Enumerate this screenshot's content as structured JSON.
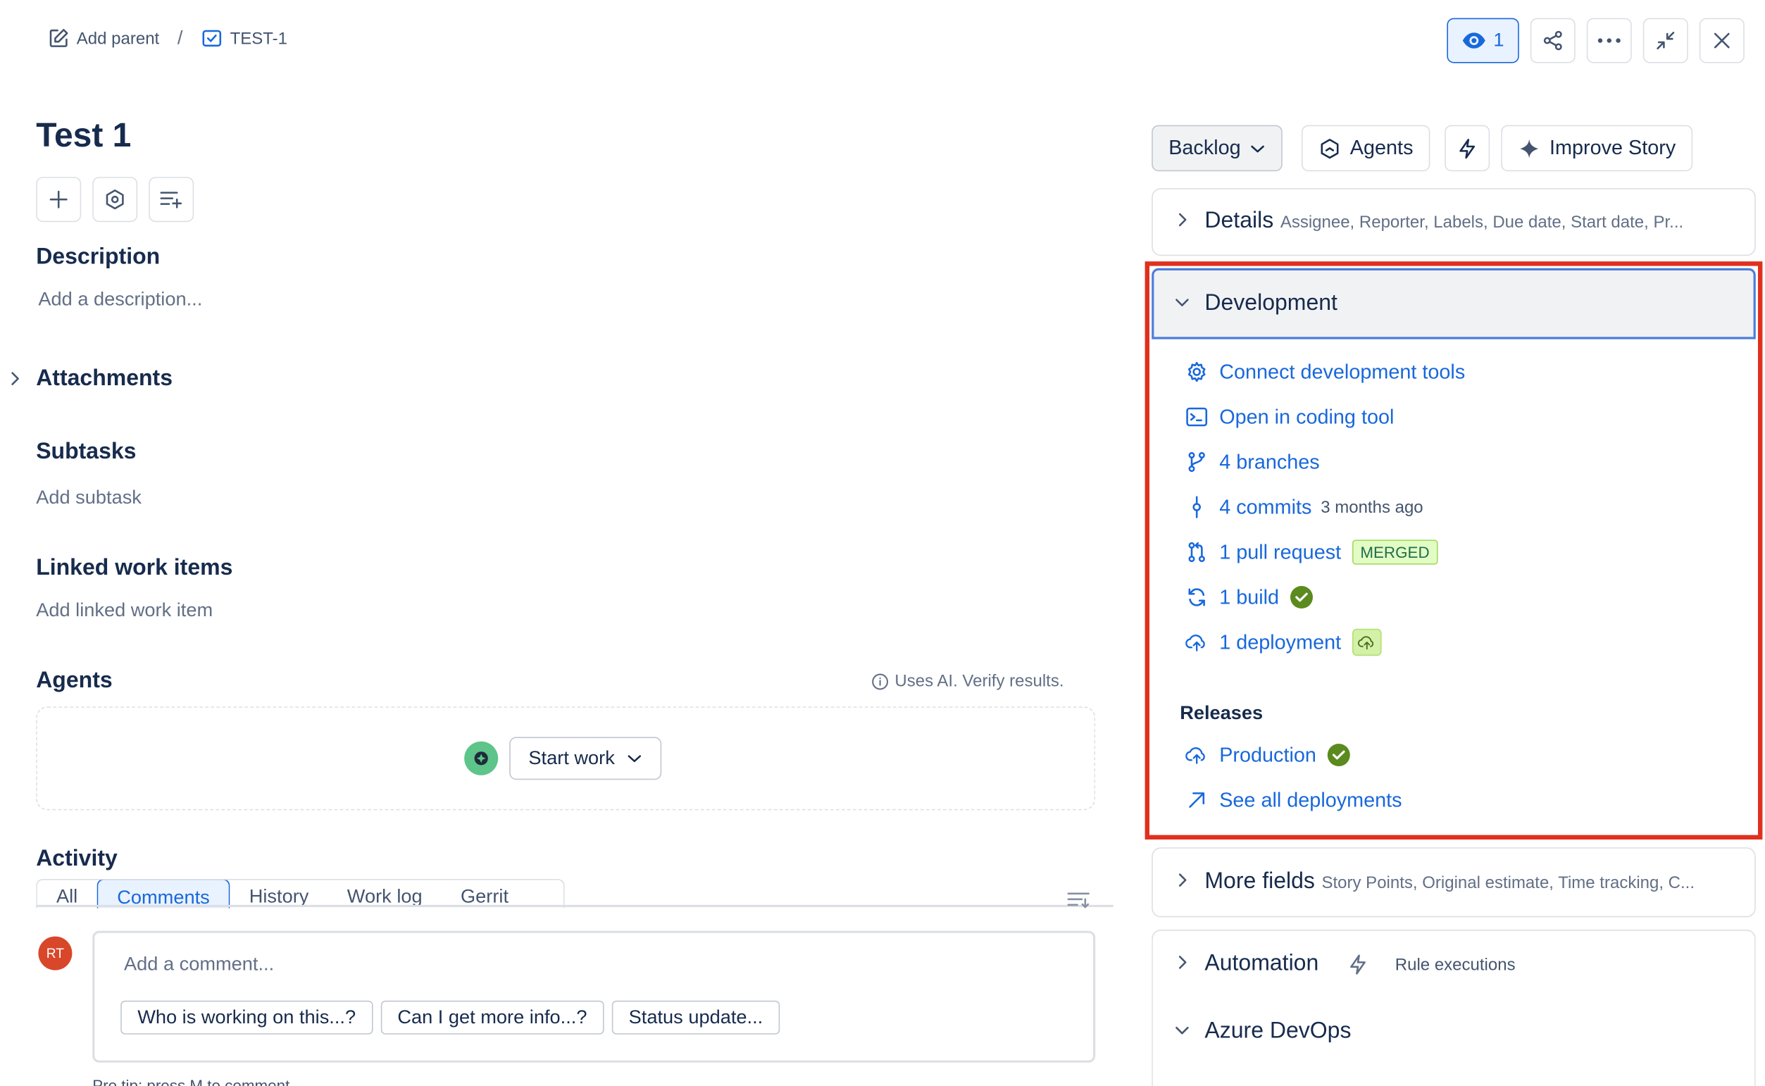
{
  "breadcrumb": {
    "add_parent": "Add parent",
    "separator": "/",
    "issue_key": "TEST-1"
  },
  "topbar": {
    "watch_count": "1"
  },
  "issue": {
    "title": "Test 1",
    "description_heading": "Description",
    "description_placeholder": "Add a description...",
    "attachments_heading": "Attachments",
    "subtasks_heading": "Subtasks",
    "subtasks_add": "Add subtask",
    "linked_heading": "Linked work items",
    "linked_add": "Add linked work item",
    "agents_heading": "Agents",
    "ai_notice": "Uses AI. Verify results.",
    "start_work": "Start work"
  },
  "activity": {
    "heading": "Activity",
    "tabs": [
      "All",
      "Comments",
      "History",
      "Work log",
      "Gerrit"
    ],
    "active_tab": "Comments",
    "avatar_initials": "RT",
    "comment_placeholder": "Add a comment...",
    "chips": [
      "Who is working on this...?",
      "Can I get more info...?",
      "Status update..."
    ],
    "pro_tip": "Pro tip: press M to comment"
  },
  "right": {
    "status": "Backlog",
    "agents_btn": "Agents",
    "improve_btn": "Improve Story",
    "details": {
      "title": "Details",
      "sub": "Assignee, Reporter, Labels, Due date, Start date, Pr..."
    },
    "development": {
      "title": "Development",
      "connect": "Connect development tools",
      "open_coding": "Open in coding tool",
      "branches": "4 branches",
      "commits": "4 commits",
      "commits_time": "3 months ago",
      "pull_request": "1 pull request",
      "merged": "MERGED",
      "build": "1 build",
      "deployment": "1 deployment",
      "releases_heading": "Releases",
      "production": "Production",
      "see_all": "See all deployments"
    },
    "more_fields": {
      "title": "More fields",
      "sub": "Story Points, Original estimate, Time tracking, C..."
    },
    "automation": {
      "title": "Automation",
      "sub": "Rule executions"
    },
    "azure": {
      "title": "Azure DevOps"
    }
  },
  "colors": {
    "link": "#1868db",
    "highlight": "#e0301e",
    "success": "#5b8a1e"
  }
}
